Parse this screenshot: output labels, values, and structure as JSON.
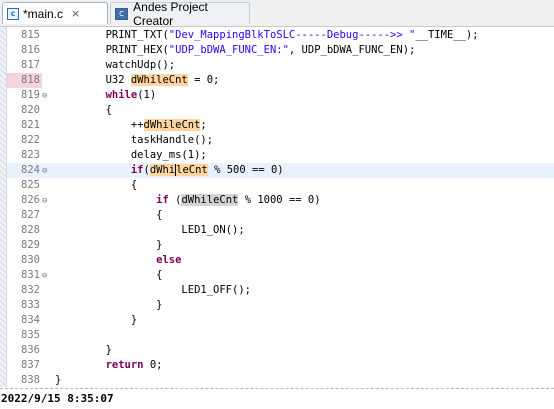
{
  "tabs": [
    {
      "label": "*main.c",
      "icon": "c-file-icon",
      "close": "×"
    },
    {
      "label": "Andes Project Creator",
      "icon": "andes-creator-icon"
    }
  ],
  "editor": {
    "lines": [
      {
        "num": "815",
        "fold": "",
        "segs": [
          {
            "t": "        PRINT_TXT("
          },
          {
            "t": "\"Dev_MappingBlkToSLC-----Debug----->> \"",
            "c": "str"
          },
          {
            "t": "__TIME__);"
          }
        ]
      },
      {
        "num": "816",
        "fold": "",
        "segs": [
          {
            "t": "        PRINT_HEX("
          },
          {
            "t": "\"UDP_bDWA_FUNC_EN:\"",
            "c": "str"
          },
          {
            "t": ", UDP_bDWA_FUNC_EN);"
          }
        ]
      },
      {
        "num": "817",
        "fold": "",
        "segs": [
          {
            "t": "        watchUdp();"
          }
        ]
      },
      {
        "num": "818",
        "fold": "",
        "hl": true,
        "segs": [
          {
            "t": "        U32 "
          },
          {
            "t": "dWhileCnt",
            "c": "occ"
          },
          {
            "t": " = 0;"
          }
        ]
      },
      {
        "num": "819",
        "fold": "⊖",
        "segs": [
          {
            "t": "        "
          },
          {
            "t": "while",
            "c": "kw"
          },
          {
            "t": "(1)"
          }
        ]
      },
      {
        "num": "820",
        "fold": "",
        "segs": [
          {
            "t": "        {"
          }
        ]
      },
      {
        "num": "821",
        "fold": "",
        "segs": [
          {
            "t": "            ++"
          },
          {
            "t": "dWhileCnt",
            "c": "occ"
          },
          {
            "t": ";"
          }
        ]
      },
      {
        "num": "822",
        "fold": "",
        "segs": [
          {
            "t": "            taskHandle();"
          }
        ]
      },
      {
        "num": "823",
        "fold": "",
        "segs": [
          {
            "t": "            delay_ms(1);"
          }
        ]
      },
      {
        "num": "824",
        "fold": "⊖",
        "current": true,
        "segs": [
          {
            "t": "            "
          },
          {
            "t": "if",
            "c": "kw"
          },
          {
            "t": "("
          },
          {
            "t": "dWhi",
            "c": "occ"
          },
          {
            "caret": true
          },
          {
            "t": "leCnt",
            "c": "occ"
          },
          {
            "t": " % 500 == 0)"
          }
        ]
      },
      {
        "num": "825",
        "fold": "",
        "segs": [
          {
            "t": "            {"
          }
        ]
      },
      {
        "num": "826",
        "fold": "⊖",
        "segs": [
          {
            "t": "                "
          },
          {
            "t": "if",
            "c": "kw"
          },
          {
            "t": " ("
          },
          {
            "t": "dWhileCnt",
            "c": "occ2"
          },
          {
            "t": " % 1000 == 0)"
          }
        ]
      },
      {
        "num": "827",
        "fold": "",
        "segs": [
          {
            "t": "                {"
          }
        ]
      },
      {
        "num": "828",
        "fold": "",
        "segs": [
          {
            "t": "                    LED1_ON();"
          }
        ]
      },
      {
        "num": "829",
        "fold": "",
        "segs": [
          {
            "t": "                }"
          }
        ]
      },
      {
        "num": "830",
        "fold": "",
        "segs": [
          {
            "t": "                "
          },
          {
            "t": "else",
            "c": "kw"
          }
        ]
      },
      {
        "num": "831",
        "fold": "⊖",
        "segs": [
          {
            "t": "                {"
          }
        ]
      },
      {
        "num": "832",
        "fold": "",
        "segs": [
          {
            "t": "                    LED1_OFF();"
          }
        ]
      },
      {
        "num": "833",
        "fold": "",
        "segs": [
          {
            "t": "                }"
          }
        ]
      },
      {
        "num": "834",
        "fold": "",
        "segs": [
          {
            "t": "            }"
          }
        ]
      },
      {
        "num": "835",
        "fold": "",
        "segs": [
          {
            "t": ""
          }
        ]
      },
      {
        "num": "836",
        "fold": "",
        "segs": [
          {
            "t": "        }"
          }
        ]
      },
      {
        "num": "837",
        "fold": "",
        "segs": [
          {
            "t": "        "
          },
          {
            "t": "return",
            "c": "kw"
          },
          {
            "t": " 0;"
          }
        ]
      },
      {
        "num": "838",
        "fold": "",
        "segs": [
          {
            "t": "}"
          }
        ]
      }
    ]
  },
  "timestamp": "2022/9/15 8:35:07"
}
